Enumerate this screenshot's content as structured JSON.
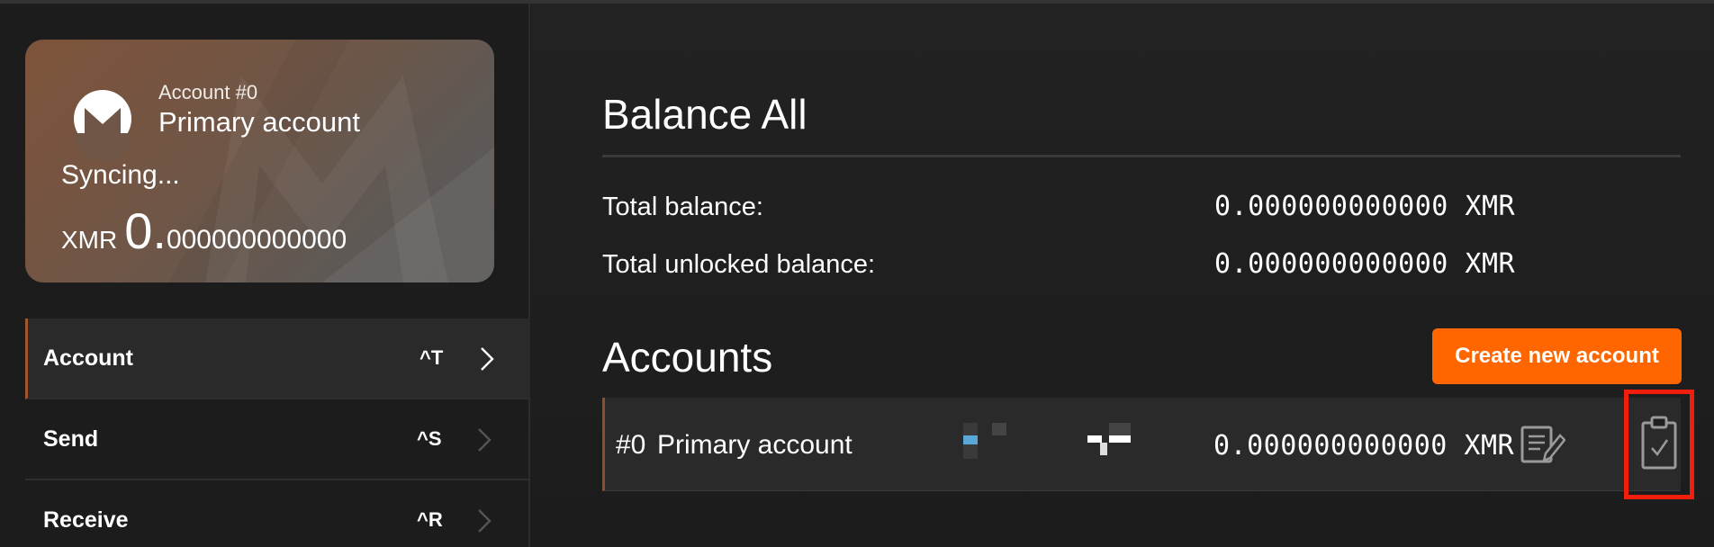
{
  "colors": {
    "accent": "#ff6600",
    "highlight_box": "#f01e0a"
  },
  "card": {
    "logo_icon": "monero-logo-icon",
    "account_number": "Account #0",
    "account_name": "Primary account",
    "status": "Syncing...",
    "currency": "XMR",
    "balance_integer": "0.",
    "balance_decimals": "000000000000"
  },
  "nav": {
    "items": [
      {
        "label": "Account",
        "shortcut": "^T",
        "active": true
      },
      {
        "label": "Send",
        "shortcut": "^S",
        "active": false
      },
      {
        "label": "Receive",
        "shortcut": "^R",
        "active": false
      }
    ]
  },
  "balance": {
    "title": "Balance All",
    "rows": [
      {
        "label": "Total balance:",
        "value": "0.000000000000 XMR"
      },
      {
        "label": "Total unlocked balance:",
        "value": "0.000000000000 XMR"
      }
    ]
  },
  "accounts": {
    "title": "Accounts",
    "create_button": "Create new account",
    "list": [
      {
        "index": "#0",
        "name": "Primary account",
        "balance": "0.000000000000 XMR",
        "icons": [
          "edit-label-icon",
          "copy-clipboard-icon"
        ]
      }
    ]
  }
}
